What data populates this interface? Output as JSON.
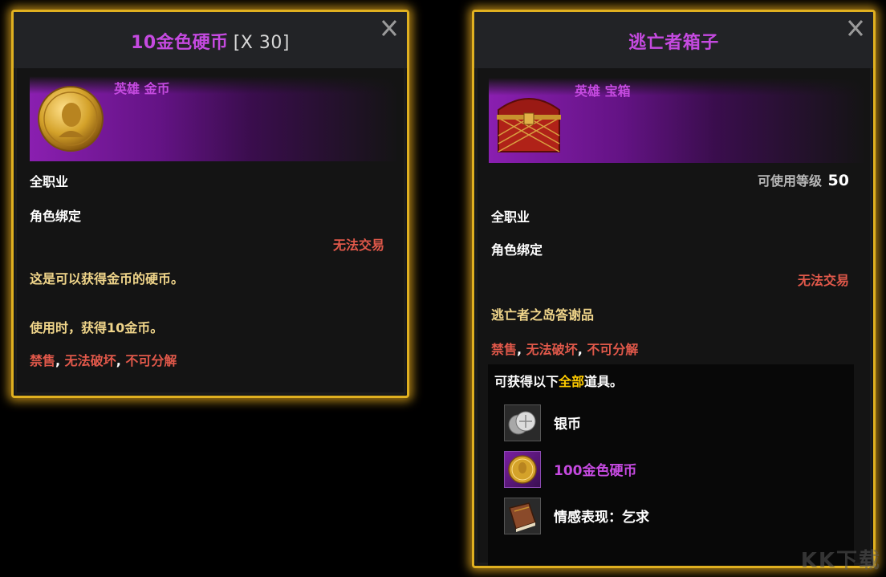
{
  "tooltip1": {
    "title": "10金色硬币",
    "quantity": "[X 30]",
    "grade": "英雄 金币",
    "class_restriction": "全职业",
    "binding": "角色绑定",
    "trade": "无法交易",
    "description": "这是可以获得金币的硬币。",
    "effect": "使用时，获得10金币。",
    "restrictions": [
      "禁售",
      "无法破坏",
      "不可分解"
    ],
    "separator": ",",
    "close_label": "X"
  },
  "tooltip2": {
    "title": "逃亡者箱子",
    "grade": "英雄 宝箱",
    "level_label": "可使用等级",
    "level_value": "50",
    "class_restriction": "全职业",
    "binding": "角色绑定",
    "trade": "无法交易",
    "source": "逃亡者之岛答谢品",
    "restrictions": [
      "禁售",
      "无法破坏",
      "不可分解"
    ],
    "separator": ",",
    "close_label": "X",
    "rewards_intro": {
      "before": "可获得以下",
      "highlight": "全部",
      "after": "道具。"
    },
    "rewards": [
      {
        "icon": "silver-coin-icon",
        "label": "银币",
        "color": "#ffffff"
      },
      {
        "icon": "gold-coin-icon",
        "label": "100金色硬币",
        "color": "#c54ae0"
      },
      {
        "icon": "book-icon",
        "label": "情感表现：乞求",
        "color": "#ffffff"
      }
    ]
  },
  "watermark": "KK下载",
  "colors": {
    "border": "#e0b020",
    "hero_purple": "#c54ae0",
    "red": "#e0584a",
    "yellow": "#f0d58a",
    "highlight": "#ffcc00"
  }
}
